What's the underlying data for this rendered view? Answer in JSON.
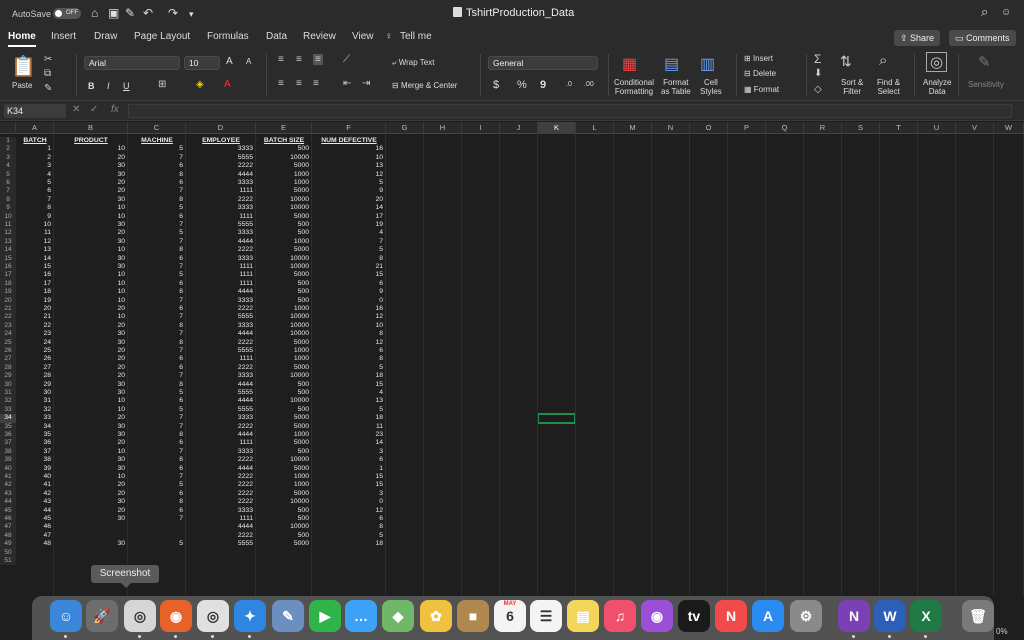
{
  "titlebar": {
    "autosave_label": "AutoSave",
    "autosave_state": "OFF",
    "document_title": "TshirtProduction_Data",
    "icons": [
      "home-icon",
      "save-icon",
      "edit-icon",
      "undo-icon",
      "redo-icon",
      "customize-icon"
    ]
  },
  "ribbon_tabs": [
    "Home",
    "Insert",
    "Draw",
    "Page Layout",
    "Formulas",
    "Data",
    "Review",
    "View"
  ],
  "tell_me": "Tell me",
  "share_label": "Share",
  "comments_label": "Comments",
  "ribbon": {
    "paste_label": "Paste",
    "font_name": "Arial",
    "font_size": "10",
    "bold": "B",
    "italic": "I",
    "underline": "U",
    "font_grow": "A",
    "font_shrink": "A",
    "wrap_text": "Wrap Text",
    "merge_center": "Merge & Center",
    "number_format": "General",
    "currency": "$",
    "percent": "%",
    "comma": "9",
    "inc_dec": ".0",
    "dec_dec": ".00",
    "conditional_formatting": [
      "Conditional",
      "Formatting"
    ],
    "format_as_table": [
      "Format",
      "as Table"
    ],
    "cell_styles": [
      "Cell",
      "Styles"
    ],
    "insert": "Insert",
    "delete": "Delete",
    "format": "Format",
    "sort_filter": [
      "Sort &",
      "Filter"
    ],
    "find_select": [
      "Find &",
      "Select"
    ],
    "analyze_data": [
      "Analyze",
      "Data"
    ],
    "sensitivity": "Sensitivity"
  },
  "formula_bar": {
    "name_box": "K34",
    "fx": "fx",
    "content": ""
  },
  "columns": [
    "A",
    "B",
    "C",
    "D",
    "E",
    "F",
    "G",
    "H",
    "I",
    "J",
    "K",
    "L",
    "M",
    "N",
    "O",
    "P",
    "Q",
    "R",
    "S",
    "T",
    "U",
    "V",
    "W"
  ],
  "selected_column": "K",
  "selected_row": "34",
  "headers": [
    "BATCH",
    "PRODUCT",
    "MACHINE",
    "EMPLOYEE",
    "BATCH SIZE",
    "NUM DEFECTIVE"
  ],
  "rows": [
    [
      "1",
      "10",
      "5",
      "3333",
      "500",
      "16"
    ],
    [
      "2",
      "20",
      "7",
      "5555",
      "10000",
      "10"
    ],
    [
      "3",
      "30",
      "6",
      "2222",
      "5000",
      "13"
    ],
    [
      "4",
      "30",
      "8",
      "4444",
      "1000",
      "12"
    ],
    [
      "5",
      "20",
      "6",
      "3333",
      "1000",
      "5"
    ],
    [
      "6",
      "20",
      "7",
      "1111",
      "5000",
      "9"
    ],
    [
      "7",
      "30",
      "8",
      "2222",
      "10000",
      "20"
    ],
    [
      "8",
      "10",
      "5",
      "3333",
      "10000",
      "14"
    ],
    [
      "9",
      "10",
      "6",
      "1111",
      "5000",
      "17"
    ],
    [
      "10",
      "30",
      "7",
      "5555",
      "500",
      "19"
    ],
    [
      "11",
      "20",
      "5",
      "3333",
      "500",
      "4"
    ],
    [
      "12",
      "30",
      "7",
      "4444",
      "1000",
      "7"
    ],
    [
      "13",
      "10",
      "8",
      "2222",
      "5000",
      "5"
    ],
    [
      "14",
      "30",
      "6",
      "3333",
      "10000",
      "8"
    ],
    [
      "15",
      "30",
      "7",
      "1111",
      "10000",
      "21"
    ],
    [
      "16",
      "10",
      "5",
      "1111",
      "5000",
      "15"
    ],
    [
      "17",
      "10",
      "6",
      "1111",
      "500",
      "6"
    ],
    [
      "18",
      "10",
      "8",
      "4444",
      "500",
      "9"
    ],
    [
      "19",
      "10",
      "7",
      "3333",
      "500",
      "0"
    ],
    [
      "20",
      "20",
      "6",
      "2222",
      "1000",
      "16"
    ],
    [
      "21",
      "10",
      "7",
      "5555",
      "10000",
      "12"
    ],
    [
      "22",
      "20",
      "8",
      "3333",
      "10000",
      "10"
    ],
    [
      "23",
      "30",
      "7",
      "4444",
      "10000",
      "8"
    ],
    [
      "24",
      "30",
      "8",
      "2222",
      "5000",
      "12"
    ],
    [
      "25",
      "20",
      "7",
      "5555",
      "1000",
      "6"
    ],
    [
      "26",
      "20",
      "6",
      "1111",
      "1000",
      "8"
    ],
    [
      "27",
      "20",
      "6",
      "2222",
      "5000",
      "5"
    ],
    [
      "28",
      "20",
      "7",
      "3333",
      "10000",
      "18"
    ],
    [
      "29",
      "30",
      "8",
      "4444",
      "500",
      "15"
    ],
    [
      "30",
      "30",
      "5",
      "5555",
      "500",
      "4"
    ],
    [
      "31",
      "10",
      "6",
      "4444",
      "10000",
      "13"
    ],
    [
      "32",
      "10",
      "5",
      "5555",
      "500",
      "5"
    ],
    [
      "33",
      "20",
      "7",
      "3333",
      "5000",
      "18"
    ],
    [
      "34",
      "30",
      "7",
      "2222",
      "5000",
      "11"
    ],
    [
      "35",
      "30",
      "8",
      "4444",
      "1000",
      "23"
    ],
    [
      "36",
      "20",
      "6",
      "1111",
      "5000",
      "14"
    ],
    [
      "37",
      "10",
      "7",
      "3333",
      "500",
      "3"
    ],
    [
      "38",
      "30",
      "8",
      "2222",
      "10000",
      "6"
    ],
    [
      "39",
      "30",
      "6",
      "4444",
      "5000",
      "1"
    ],
    [
      "40",
      "10",
      "7",
      "2222",
      "1000",
      "15"
    ],
    [
      "41",
      "20",
      "5",
      "2222",
      "1000",
      "15"
    ],
    [
      "42",
      "20",
      "6",
      "2222",
      "5000",
      "3"
    ],
    [
      "43",
      "30",
      "8",
      "2222",
      "10000",
      "0"
    ],
    [
      "44",
      "20",
      "6",
      "3333",
      "500",
      "12"
    ],
    [
      "45",
      "30",
      "7",
      "1111",
      "500",
      "6"
    ],
    [
      "46",
      "",
      "",
      "4444",
      "10000",
      "8"
    ],
    [
      "47",
      "",
      "",
      "2222",
      "500",
      "5"
    ],
    [
      "48",
      "30",
      "5",
      "5555",
      "5000",
      "18"
    ]
  ],
  "tooltip": "Screenshot",
  "zoom": "0%",
  "dock": [
    {
      "name": "finder-icon",
      "label": "☺",
      "color": "#3a86d9"
    },
    {
      "name": "launchpad-icon",
      "label": "🚀",
      "color": "#6d6d6d"
    },
    {
      "name": "screenshot-icon",
      "label": "◎",
      "color": "#d6d6d6"
    },
    {
      "name": "firefox-icon",
      "label": "◉",
      "color": "#e8632a"
    },
    {
      "name": "chrome-icon",
      "label": "◎",
      "color": "#e0e0e0"
    },
    {
      "name": "safari-icon",
      "label": "✦",
      "color": "#2f86e0"
    },
    {
      "name": "preview-icon",
      "label": "✎",
      "color": "#6b8fbf"
    },
    {
      "name": "facetime-icon",
      "label": "▶",
      "color": "#2fb44a"
    },
    {
      "name": "messages-icon",
      "label": "…",
      "color": "#3ca2f5"
    },
    {
      "name": "maps-icon",
      "label": "◆",
      "color": "#6fb86a"
    },
    {
      "name": "photos-icon",
      "label": "✿",
      "color": "#f0c040"
    },
    {
      "name": "contacts-icon",
      "label": "■",
      "color": "#b08850"
    },
    {
      "name": "calendar-icon",
      "label": "6",
      "color": "#f4f4f4"
    },
    {
      "name": "reminders-icon",
      "label": "☰",
      "color": "#f4f4f4"
    },
    {
      "name": "notes-icon",
      "label": "▤",
      "color": "#f2d55a"
    },
    {
      "name": "music-icon",
      "label": "♫",
      "color": "#f0506e"
    },
    {
      "name": "podcasts-icon",
      "label": "◉",
      "color": "#9b4fd6"
    },
    {
      "name": "apple-tv-icon",
      "label": "tv",
      "color": "#1a1a1a"
    },
    {
      "name": "news-icon",
      "label": "N",
      "color": "#f04a4a"
    },
    {
      "name": "app-store-icon",
      "label": "A",
      "color": "#2a8cf0"
    },
    {
      "name": "system-preferences-icon",
      "label": "⚙",
      "color": "#8a8a8a"
    },
    {
      "name": "onenote-icon",
      "label": "N",
      "color": "#7b3fb6"
    },
    {
      "name": "word-icon",
      "label": "W",
      "color": "#2b5fb8"
    },
    {
      "name": "excel-icon",
      "label": "X",
      "color": "#1f7a45"
    },
    {
      "name": "trash-icon",
      "label": "🗑",
      "color": "#7a7a7a"
    }
  ],
  "calendar_month": "MAY"
}
